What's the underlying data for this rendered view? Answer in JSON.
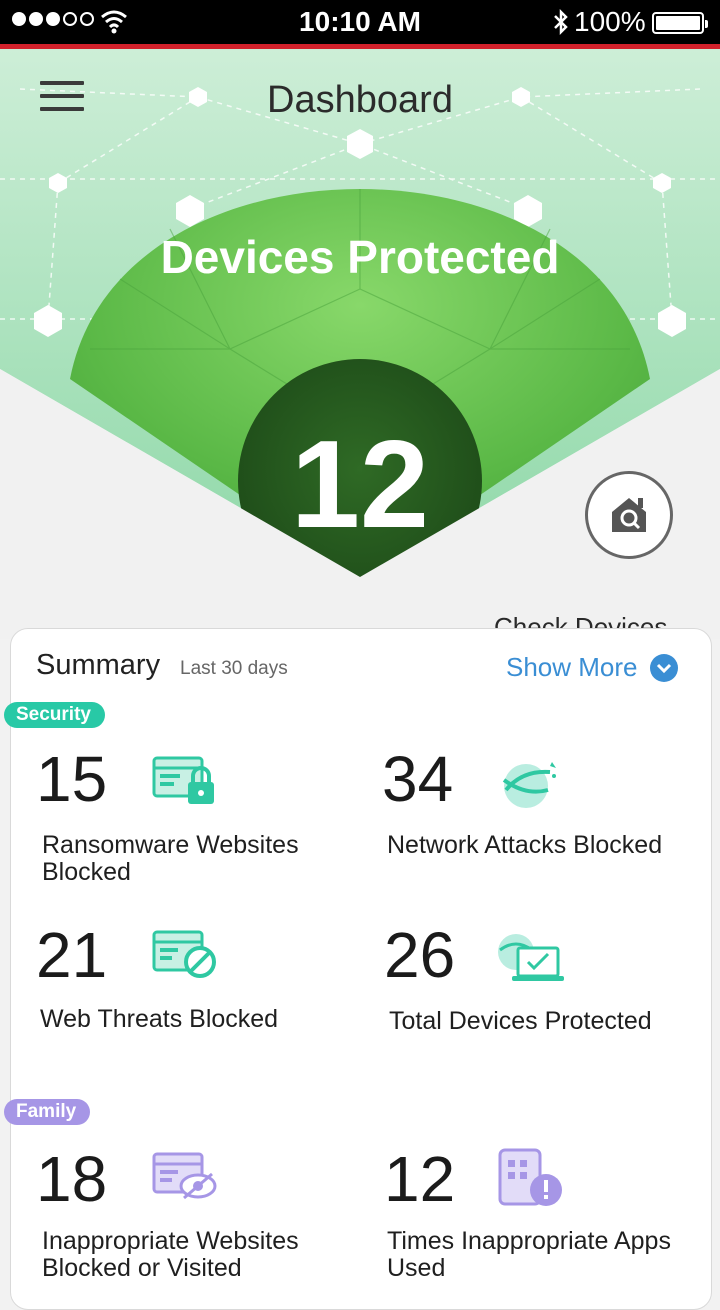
{
  "status_bar": {
    "time": "10:10 AM",
    "battery": "100%"
  },
  "header": {
    "title": "Dashboard",
    "menu_icon": "hamburger-menu-icon"
  },
  "hero": {
    "label": "Devices Protected",
    "count": "12",
    "check_devices_label": "Check Devices",
    "check_icon": "house-search-icon"
  },
  "summary": {
    "title": "Summary",
    "period": "Last 30 days",
    "show_more": "Show More",
    "sections": [
      {
        "badge": "Security",
        "color": "#28c9a6",
        "stats": [
          {
            "value": "15",
            "label": "Ransomware Websites Blocked",
            "icon": "browser-lock-icon"
          },
          {
            "value": "34",
            "label": "Network Attacks Blocked",
            "icon": "network-attack-icon"
          },
          {
            "value": "21",
            "label": "Web Threats Blocked",
            "icon": "browser-blocked-icon"
          },
          {
            "value": "26",
            "label": "Total Devices Protected",
            "icon": "devices-protected-icon"
          }
        ]
      },
      {
        "badge": "Family",
        "color": "#a696e6",
        "stats": [
          {
            "value": "18",
            "label": "Inappropriate Websites Blocked or Visited",
            "icon": "browser-hidden-icon"
          },
          {
            "value": "12",
            "label": "Times Inappropriate Apps Used",
            "icon": "app-alert-icon"
          }
        ]
      }
    ]
  },
  "colors": {
    "accent_red": "#d3212b",
    "dome_green": "#5fbf4a",
    "link_blue": "#3a8ed4"
  }
}
